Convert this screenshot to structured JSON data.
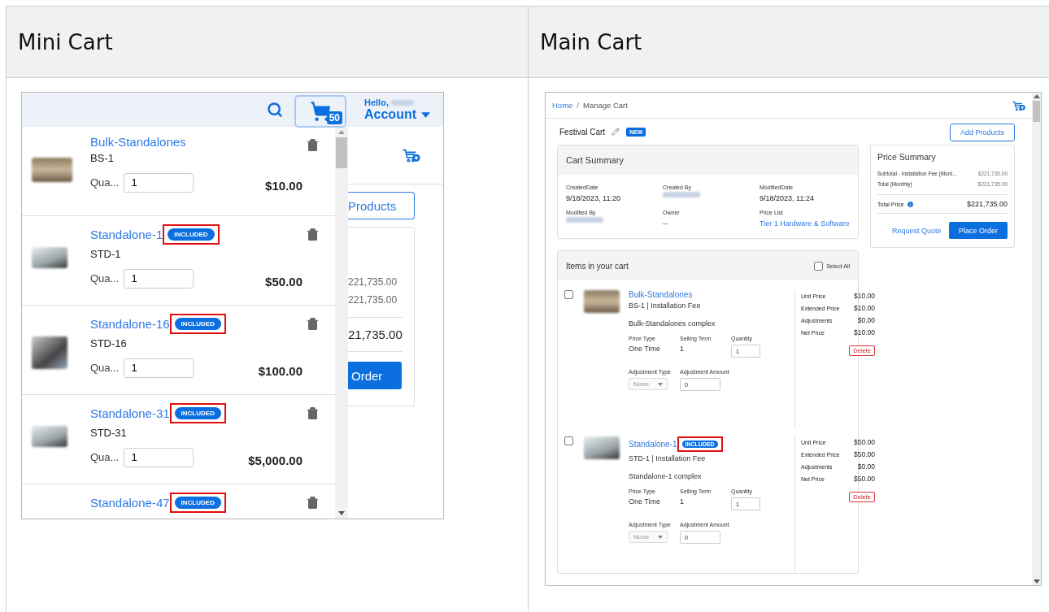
{
  "table": {
    "columns": [
      "Mini Cart",
      "Main Cart"
    ]
  },
  "mini_cart": {
    "header": {
      "cart_count": "50",
      "greeting": "Hello,",
      "account": "Account"
    },
    "items": [
      {
        "name": "Bulk-Standalones",
        "code": "BS-1",
        "quantity_label": "Qua...",
        "quantity": "1",
        "price": "$10.00"
      },
      {
        "name": "Standalone-1",
        "badge": "INCLUDED",
        "code": "STD-1",
        "quantity_label": "Qua...",
        "quantity": "1",
        "price": "$50.00",
        "highlighted": true
      },
      {
        "name": "Standalone-16",
        "badge": "INCLUDED",
        "code": "STD-16",
        "quantity_label": "Qua...",
        "quantity": "1",
        "price": "$100.00",
        "highlighted": true
      },
      {
        "name": "Standalone-31",
        "badge": "INCLUDED",
        "code": "STD-31",
        "quantity_label": "Qua...",
        "quantity": "1",
        "price": "$5,000.00",
        "highlighted": true
      },
      {
        "name": "Standalone-47",
        "badge": "INCLUDED",
        "highlighted": true
      }
    ],
    "background": {
      "button": "Products",
      "amounts": [
        "221,735.00",
        "221,735.00"
      ],
      "total": "21,735.00",
      "order_button": "Order"
    }
  },
  "main_cart": {
    "breadcrumb": [
      {
        "label": "Home",
        "kind": "link"
      },
      {
        "label": "/",
        "kind": "separator"
      },
      {
        "label": "Manage Cart",
        "kind": "current"
      }
    ],
    "cart_name": "Festival Cart",
    "status_badge": "NEW",
    "add_button": "Add Products",
    "cart_summary": {
      "title": "Cart Summary",
      "fields": [
        {
          "label": "CreatedDate",
          "value": "9/18/2023, 11:20",
          "kind": "text"
        },
        {
          "label": "Created By",
          "kind": "redacted"
        },
        {
          "label": "ModifiedDate",
          "value": "9/18/2023, 11:24",
          "kind": "text"
        },
        {
          "label": "Modified By",
          "kind": "redacted"
        },
        {
          "label": "Owner",
          "value": "--",
          "kind": "text"
        },
        {
          "label": "Price List",
          "value": "Tier 1 Hardware & Software",
          "kind": "link"
        }
      ]
    },
    "price_summary": {
      "title": "Price Summary",
      "lines": [
        {
          "label": "Subtotal - Installation Fee (Mont...",
          "value": "$221,735.00"
        },
        {
          "label": "Total (Monthly)",
          "value": "$221,735.00"
        }
      ],
      "total_label": "Total Price",
      "total": "$221,735.00",
      "request_quote": "Request Quote",
      "place_order": "Place Order"
    },
    "items_panel": {
      "title": "Items in your cart",
      "select_all": {
        "label": "Select All",
        "checked": false
      },
      "items": [
        {
          "checked": false,
          "name": "Bulk-Standalones",
          "code_line": "BS-1 | Installation Fee",
          "description": "Bulk-Standalones complex",
          "fields": [
            {
              "label": "Price Type",
              "value": "One Time",
              "kind": "text"
            },
            {
              "label": "Selling Term",
              "value": "1",
              "kind": "text"
            },
            {
              "label": "Quantity",
              "value": "1",
              "kind": "input"
            },
            {
              "label": "Adjustment Type",
              "value": "None",
              "kind": "select",
              "disabled": true
            },
            {
              "label": "Adjustment Amount",
              "value": "0",
              "kind": "input"
            }
          ],
          "prices": [
            {
              "label": "Unit Price",
              "value": "$10.00"
            },
            {
              "label": "Extended Price",
              "value": "$10.00"
            },
            {
              "label": "Adjustments",
              "value": "$0.00"
            },
            {
              "label": "Net Price",
              "value": "$10.00"
            }
          ],
          "delete": "Delete"
        },
        {
          "checked": false,
          "name": "Standalone-1",
          "badge": "INCLUDED",
          "highlighted": true,
          "code_line": "STD-1 | Installation Fee",
          "description": "Standalone-1 complex",
          "fields": [
            {
              "label": "Price Type",
              "value": "One Time",
              "kind": "text"
            },
            {
              "label": "Selling Term",
              "value": "1",
              "kind": "text"
            },
            {
              "label": "Quantity",
              "value": "1",
              "kind": "input"
            },
            {
              "label": "Adjustment Type",
              "value": "None",
              "kind": "select",
              "disabled": true
            },
            {
              "label": "Adjustment Amount",
              "value": "0",
              "kind": "input"
            }
          ],
          "prices": [
            {
              "label": "Unit Price",
              "value": "$50.00"
            },
            {
              "label": "Extended Price",
              "value": "$50.00"
            },
            {
              "label": "Adjustments",
              "value": "$0.00"
            },
            {
              "label": "Net Price",
              "value": "$50.00"
            }
          ],
          "delete": "Delete"
        }
      ]
    }
  }
}
